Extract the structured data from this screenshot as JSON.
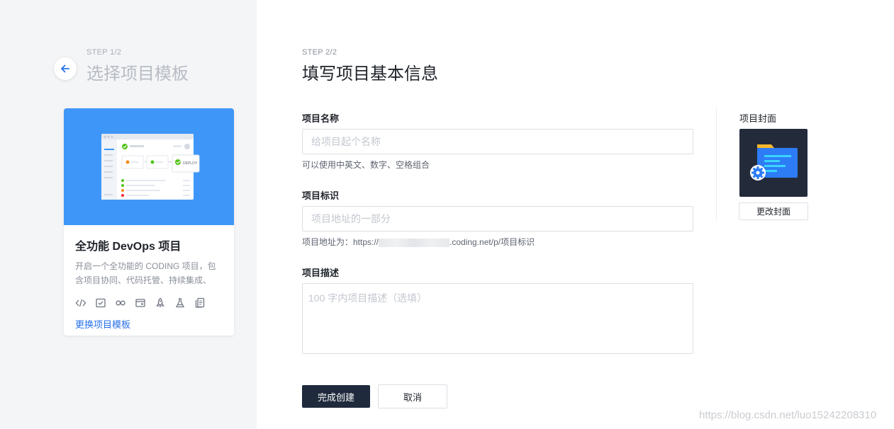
{
  "left": {
    "step": "STEP 1/2",
    "title": "选择项目模板",
    "card": {
      "banner_deploy_label": "DEPLOY",
      "title": "全功能 DevOps 项目",
      "description": "开启一个全功能的 CODING 项目，包含项目协同、代码托管、持续集成、持...",
      "feature_icons": [
        "code-icon",
        "checklist-icon",
        "infinity-icon",
        "window-icon",
        "rocket-icon",
        "flask-icon",
        "document-icon"
      ],
      "change_link": "更换项目模板"
    }
  },
  "form": {
    "step": "STEP 2/2",
    "title": "填写项目基本信息",
    "name": {
      "label": "项目名称",
      "placeholder": "给项目起个名称",
      "hint": "可以使用中英文、数字、空格组合"
    },
    "identifier": {
      "label": "项目标识",
      "placeholder": "项目地址的一部分",
      "hint_prefix": "项目地址为：https://",
      "hint_suffix": ".coding.net/p/项目标识"
    },
    "description": {
      "label": "项目描述",
      "placeholder": "100 字内项目描述（选填）"
    },
    "submit_label": "完成创建",
    "cancel_label": "取消"
  },
  "cover": {
    "label": "项目封面",
    "change_label": "更改封面"
  },
  "watermark": "https://blog.csdn.net/luo15242208310",
  "colors": {
    "accent": "#2670e8",
    "banner": "#3e97f8",
    "primary_button": "#1f2a3c",
    "left_pane_bg": "#f4f5f7",
    "cover_bg": "#232b3b"
  }
}
